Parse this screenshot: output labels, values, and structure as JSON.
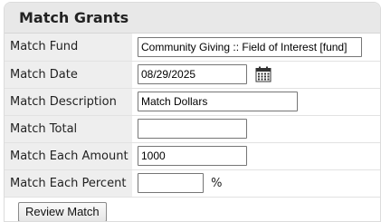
{
  "panel": {
    "title": "Match Grants"
  },
  "fields": {
    "fund": {
      "label": "Match Fund",
      "value": "Community Giving :: Field of Interest [fund]"
    },
    "date": {
      "label": "Match Date",
      "value": "08/29/2025"
    },
    "description": {
      "label": "Match Description",
      "value": "Match Dollars"
    },
    "total": {
      "label": "Match Total",
      "value": ""
    },
    "each_amount": {
      "label": "Match Each Amount",
      "value": "1000"
    },
    "each_percent": {
      "label": "Match Each Percent",
      "value": "",
      "suffix": "%"
    }
  },
  "actions": {
    "review_label": "Review Match"
  },
  "icons": {
    "date_picker": "calendar-icon"
  },
  "colors": {
    "header_bg": "#e8e8e8",
    "label_bg": "#eeeeee",
    "border": "#dcdcdc"
  }
}
